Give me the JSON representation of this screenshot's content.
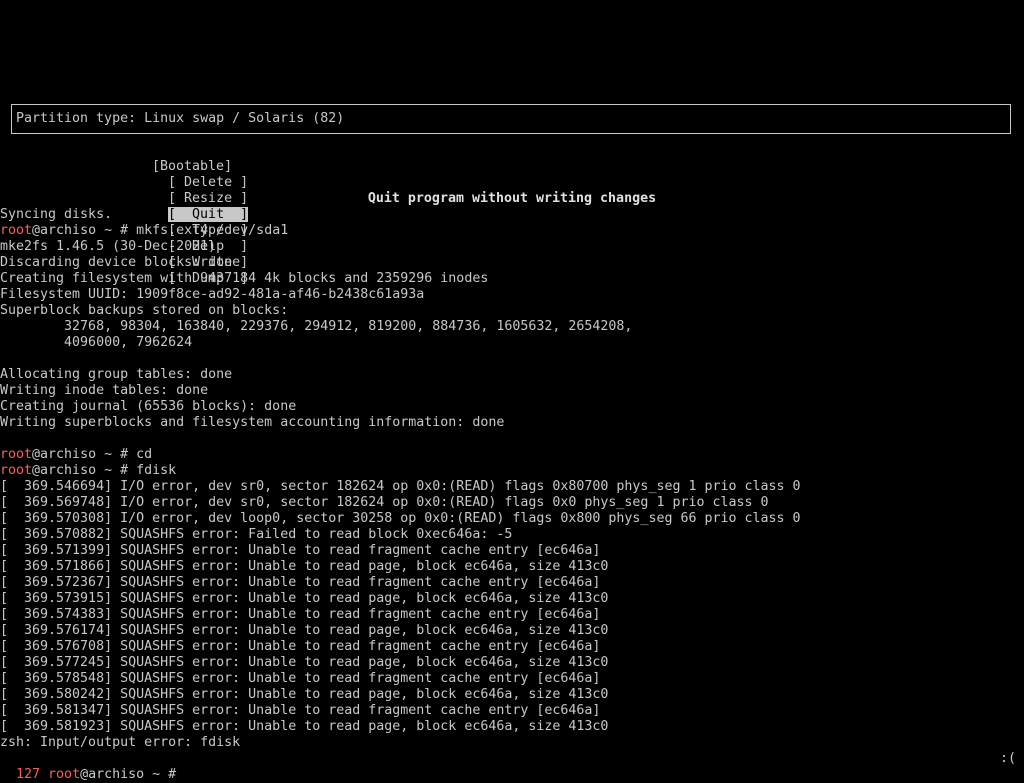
{
  "partition": {
    "label": "Partition type: Linux swap / Solaris (82)"
  },
  "menu": {
    "items": [
      "[Bootable]",
      "[ Delete ]",
      "[ Resize ]",
      "[  Quit  ]",
      "[  Type  ]",
      "[  Help  ]",
      "[  Write ]",
      "[  Dump  ]"
    ],
    "selected": "[  Quit  ]"
  },
  "hint": "Quit program without writing changes",
  "terminal": {
    "lines": [
      {
        "prompt": "",
        "text": "Syncing disks."
      },
      {
        "prompt": "root",
        "text": "@archiso ~ # mkfs.ext4 /dev/sda1"
      },
      {
        "prompt": "",
        "text": "mke2fs 1.46.5 (30-Dec-2021)"
      },
      {
        "prompt": "",
        "text": "Discarding device blocks: done"
      },
      {
        "prompt": "",
        "text": "Creating filesystem with 9437184 4k blocks and 2359296 inodes"
      },
      {
        "prompt": "",
        "text": "Filesystem UUID: 1909f8ce-ad92-481a-af46-b2438c61a93a"
      },
      {
        "prompt": "",
        "text": "Superblock backups stored on blocks:"
      },
      {
        "prompt": "",
        "text": "        32768, 98304, 163840, 229376, 294912, 819200, 884736, 1605632, 2654208,"
      },
      {
        "prompt": "",
        "text": "        4096000, 7962624"
      },
      {
        "prompt": "",
        "text": ""
      },
      {
        "prompt": "",
        "text": "Allocating group tables: done"
      },
      {
        "prompt": "",
        "text": "Writing inode tables: done"
      },
      {
        "prompt": "",
        "text": "Creating journal (65536 blocks): done"
      },
      {
        "prompt": "",
        "text": "Writing superblocks and filesystem accounting information: done"
      },
      {
        "prompt": "",
        "text": ""
      },
      {
        "prompt": "root",
        "text": "@archiso ~ # cd"
      },
      {
        "prompt": "root",
        "text": "@archiso ~ # fdisk"
      },
      {
        "prompt": "",
        "text": "[  369.546694] I/O error, dev sr0, sector 182624 op 0x0:(READ) flags 0x80700 phys_seg 1 prio class 0"
      },
      {
        "prompt": "",
        "text": "[  369.569748] I/O error, dev sr0, sector 182624 op 0x0:(READ) flags 0x0 phys_seg 1 prio class 0"
      },
      {
        "prompt": "",
        "text": "[  369.570308] I/O error, dev loop0, sector 30258 op 0x0:(READ) flags 0x800 phys_seg 66 prio class 0"
      },
      {
        "prompt": "",
        "text": "[  369.570882] SQUASHFS error: Failed to read block 0xec646a: -5"
      },
      {
        "prompt": "",
        "text": "[  369.571399] SQUASHFS error: Unable to read fragment cache entry [ec646a]"
      },
      {
        "prompt": "",
        "text": "[  369.571866] SQUASHFS error: Unable to read page, block ec646a, size 413c0"
      },
      {
        "prompt": "",
        "text": "[  369.572367] SQUASHFS error: Unable to read fragment cache entry [ec646a]"
      },
      {
        "prompt": "",
        "text": "[  369.573915] SQUASHFS error: Unable to read page, block ec646a, size 413c0"
      },
      {
        "prompt": "",
        "text": "[  369.574383] SQUASHFS error: Unable to read fragment cache entry [ec646a]"
      },
      {
        "prompt": "",
        "text": "[  369.576174] SQUASHFS error: Unable to read page, block ec646a, size 413c0"
      },
      {
        "prompt": "",
        "text": "[  369.576708] SQUASHFS error: Unable to read fragment cache entry [ec646a]"
      },
      {
        "prompt": "",
        "text": "[  369.577245] SQUASHFS error: Unable to read page, block ec646a, size 413c0"
      },
      {
        "prompt": "",
        "text": "[  369.578548] SQUASHFS error: Unable to read fragment cache entry [ec646a]"
      },
      {
        "prompt": "",
        "text": "[  369.580242] SQUASHFS error: Unable to read page, block ec646a, size 413c0"
      },
      {
        "prompt": "",
        "text": "[  369.581347] SQUASHFS error: Unable to read fragment cache entry [ec646a]"
      },
      {
        "prompt": "",
        "text": "[  369.581923] SQUASHFS error: Unable to read page, block ec646a, size 413c0"
      },
      {
        "prompt": "",
        "text": "zsh: Input/output error: fdisk"
      }
    ],
    "final_prompt": {
      "code": "127 ",
      "user": "root",
      "rest": "@archiso ~ # "
    }
  },
  "status_face": ":(",
  "colors": {
    "fg": "#c8c8c8",
    "bg": "#000000",
    "prompt_red": "#ff5a5a"
  }
}
